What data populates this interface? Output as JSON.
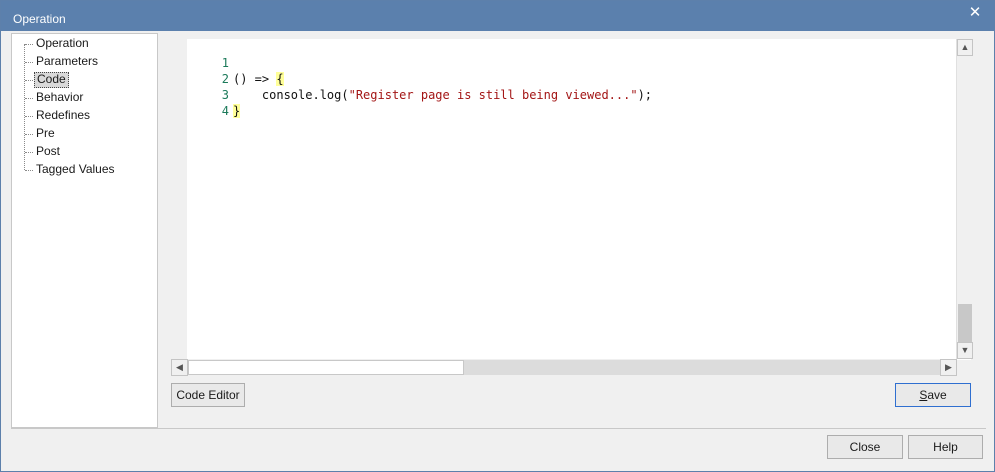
{
  "window": {
    "title": "Operation",
    "close_glyph": "✕"
  },
  "tree": {
    "items": [
      {
        "label": "Operation",
        "selected": false
      },
      {
        "label": "Parameters",
        "selected": false
      },
      {
        "label": "Code",
        "selected": true
      },
      {
        "label": "Behavior",
        "selected": false
      },
      {
        "label": "Redefines",
        "selected": false
      },
      {
        "label": "Pre",
        "selected": false
      },
      {
        "label": "Post",
        "selected": false
      },
      {
        "label": "Tagged Values",
        "selected": false
      }
    ]
  },
  "editor": {
    "lines": [
      {
        "number": "1",
        "text_before": "() => ",
        "brace": "{",
        "string": "",
        "text_after": ""
      },
      {
        "number": "2",
        "text_before": "    console.log(",
        "brace": "",
        "string": "\"Register page is still being viewed...\"",
        "text_after": ");"
      },
      {
        "number": "3",
        "text_before": "",
        "brace": "}",
        "string": "",
        "text_after": ""
      },
      {
        "number": "4",
        "text_before": "",
        "brace": "",
        "string": "",
        "text_after": ""
      }
    ]
  },
  "buttons": {
    "code_editor": "Code Editor",
    "save": "Save",
    "save_mnemonic": "S",
    "save_rest": "ave",
    "close": "Close",
    "help": "Help"
  },
  "colors": {
    "titlebar": "#5b80ad",
    "line_number": "#1c7a5a",
    "string": "#a31515",
    "brace_highlight": "#ffff99"
  }
}
